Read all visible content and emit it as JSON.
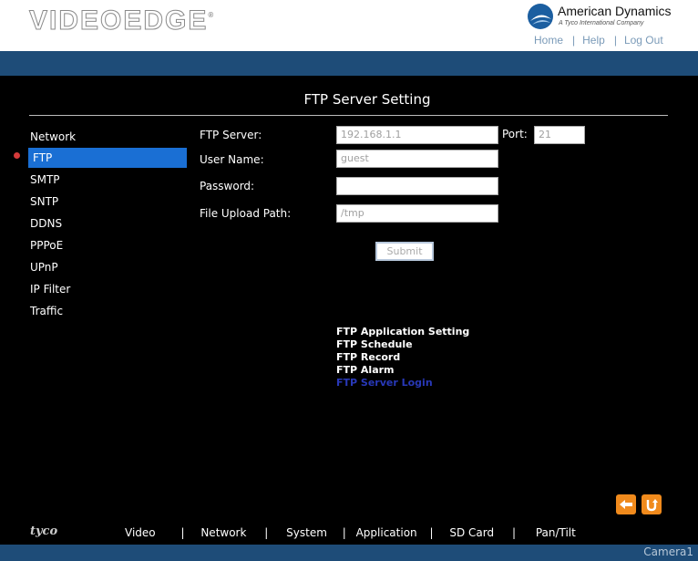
{
  "header": {
    "logo": "VIDEOEDGE",
    "brand_name": "American Dynamics",
    "brand_sub": "A Tyco International Company",
    "links": [
      "Home",
      "Help",
      "Log Out"
    ]
  },
  "page_title": "FTP Server Setting",
  "sidebar": {
    "items": [
      "Network",
      "FTP",
      "SMTP",
      "SNTP",
      "DDNS",
      "PPPoE",
      "UPnP",
      "IP Filter",
      "Traffic"
    ],
    "active": "FTP"
  },
  "form": {
    "ftp_server_label": "FTP Server:",
    "ftp_server_value": "192.168.1.1",
    "port_label": "Port:",
    "port_value": "21",
    "user_name_label": "User Name:",
    "user_name_value": "guest",
    "password_label": "Password:",
    "password_value": "",
    "upload_path_label": "File Upload Path:",
    "upload_path_value": "/tmp",
    "submit_label": "Submit"
  },
  "sublinks": [
    "FTP Application Setting",
    "FTP Schedule",
    "FTP Record",
    "FTP Alarm",
    "FTP Server Login"
  ],
  "bottom": {
    "brand": "tyco",
    "nav": [
      "Video",
      "Network",
      "System",
      "Application",
      "SD Card",
      "Pan/Tilt"
    ],
    "camera": "Camera1"
  },
  "colors": {
    "accent_blue": "#1e4c78",
    "active_item": "#1a6fd4",
    "orange_button": "#f08a1c",
    "current_link": "#2838b8"
  },
  "icons": [
    "back-arrow-icon",
    "refresh-icon",
    "active-dot-icon",
    "american-dynamics-logo-icon"
  ]
}
